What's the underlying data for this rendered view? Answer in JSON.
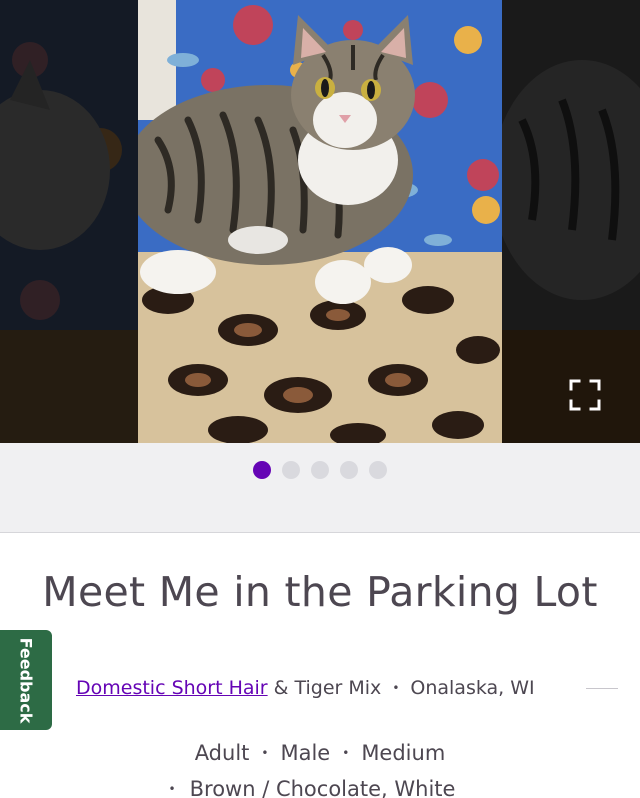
{
  "carousel": {
    "slides_count": 5,
    "active_index": 0,
    "fullscreen_icon": "expand-icon"
  },
  "pet": {
    "name": "Meet Me in the Parking Lot",
    "breed_primary": "Domestic Short Hair",
    "breed_secondary": "& Tiger Mix",
    "location": "Onalaska, WI",
    "age": "Adult",
    "sex": "Male",
    "size": "Medium",
    "colors": "Brown / Chocolate, White"
  },
  "separator": "•",
  "feedback": {
    "label": "Feedback"
  },
  "colors": {
    "accent": "#6504b5",
    "feedback_bg": "#2d6b45",
    "text": "#4d4751"
  }
}
